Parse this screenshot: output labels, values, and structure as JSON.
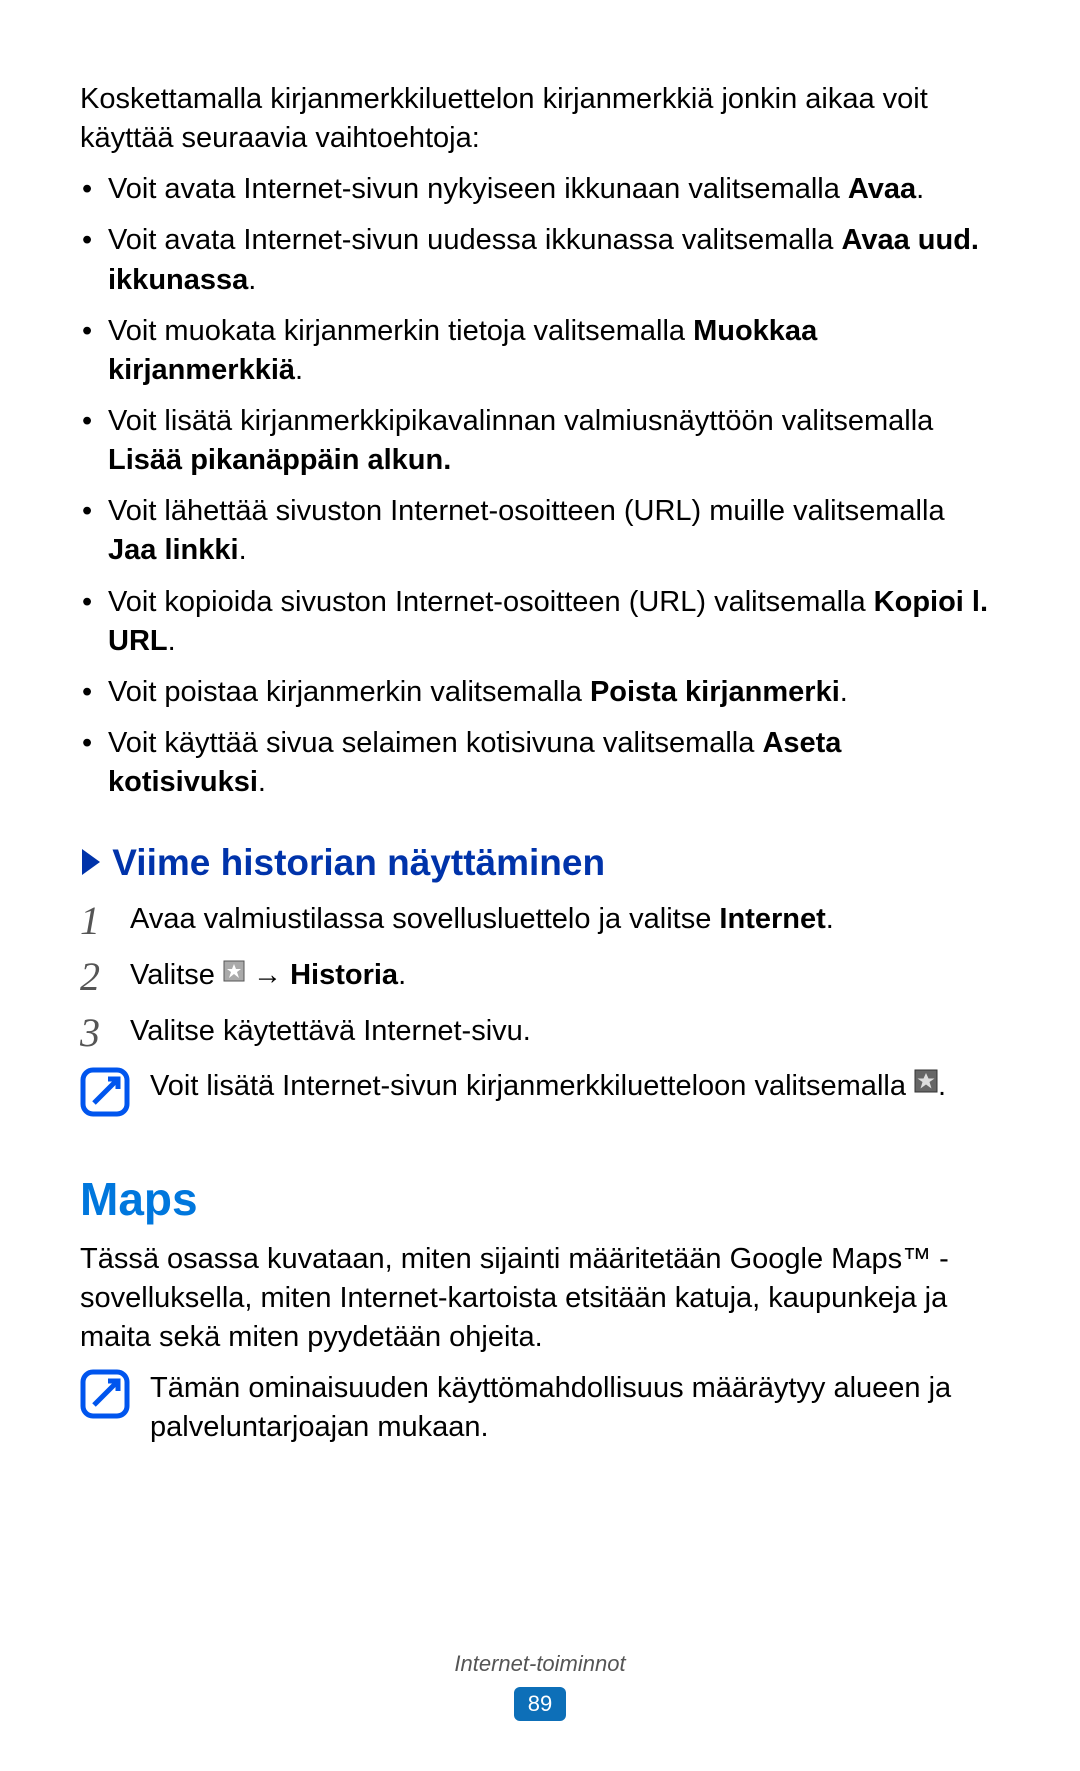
{
  "intro": "Koskettamalla kirjanmerkkiluettelon kirjanmerkkiä jonkin aikaa voit käyttää seuraavia vaihtoehtoja:",
  "bullets": [
    {
      "pre": "Voit avata Internet-sivun nykyiseen ikkunaan valitsemalla ",
      "bold": "Avaa",
      "post": "."
    },
    {
      "pre": "Voit avata Internet-sivun uudessa ikkunassa valitsemalla ",
      "bold": "Avaa uud. ikkunassa",
      "post": "."
    },
    {
      "pre": "Voit muokata kirjanmerkin tietoja valitsemalla ",
      "bold": "Muokkaa kirjanmerkkiä",
      "post": "."
    },
    {
      "pre": "Voit lisätä kirjanmerkkipikavalinnan valmiusnäyttöön valitsemalla ",
      "bold": "Lisää pikanäppäin alkun.",
      "post": ""
    },
    {
      "pre": "Voit lähettää sivuston Internet-osoitteen (URL) muille valitsemalla ",
      "bold": "Jaa linkki",
      "post": "."
    },
    {
      "pre": "Voit kopioida sivuston Internet-osoitteen (URL) valitsemalla ",
      "bold": "Kopioi l. URL",
      "post": "."
    },
    {
      "pre": "Voit poistaa kirjanmerkin valitsemalla ",
      "bold": "Poista kirjanmerki",
      "post": "."
    },
    {
      "pre": "Voit käyttää sivua selaimen kotisivuna valitsemalla ",
      "bold": "Aseta kotisivuksi",
      "post": "."
    }
  ],
  "subheading": "Viime historian näyttäminen",
  "steps": {
    "s1_pre": "Avaa valmiustilassa sovellusluettelo ja valitse ",
    "s1_bold": "Internet",
    "s1_post": ".",
    "s2_pre": "Valitse ",
    "s2_arrow": " → ",
    "s2_bold": "Historia",
    "s2_post": ".",
    "s3": "Valitse käytettävä Internet-sivu."
  },
  "note1_pre": "Voit lisätä Internet-sivun kirjanmerkkiluetteloon valitsemalla ",
  "note1_post": ".",
  "main_heading": "Maps",
  "maps_para": "Tässä osassa kuvataan, miten sijainti määritetään Google Maps™ -sovelluksella, miten Internet-kartoista etsitään katuja, kaupunkeja ja maita sekä miten pyydetään ohjeita.",
  "note2": "Tämän ominaisuuden käyttömahdollisuus määräytyy alueen ja palveluntarjoajan mukaan.",
  "footer_label": "Internet-toiminnot",
  "page_number": "89"
}
